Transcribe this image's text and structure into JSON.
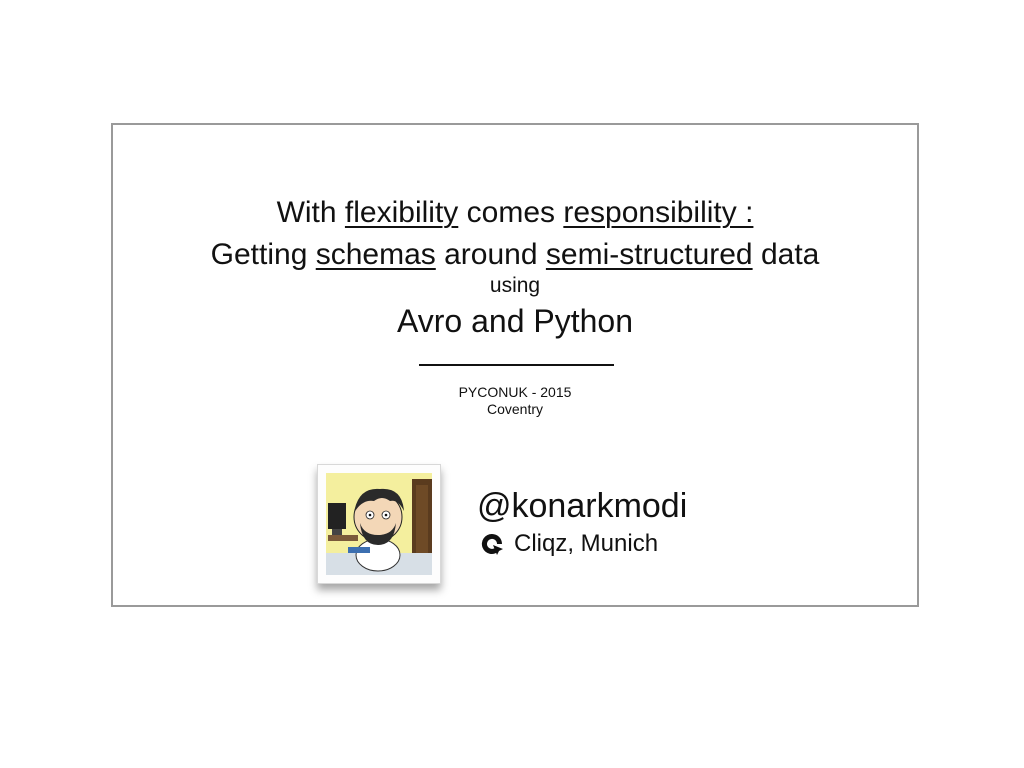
{
  "title": {
    "line1": {
      "w1": "With",
      "u1": "flexibility",
      "w2": "comes",
      "u2": "responsibility :"
    },
    "line2": {
      "w1": "Getting",
      "u1": "schemas",
      "w2": "around",
      "u2": "semi-structured",
      "w3": "data"
    },
    "using": "using",
    "subtitle": "Avro and Python"
  },
  "event": {
    "name": "PYCONUK - 2015",
    "city": "Coventry"
  },
  "speaker": {
    "handle": "@konarkmodi",
    "company": "Cliqz, Munich",
    "avatar_icon": "cartoon-avatar-icon",
    "company_icon": "cliqz-logo-icon"
  }
}
